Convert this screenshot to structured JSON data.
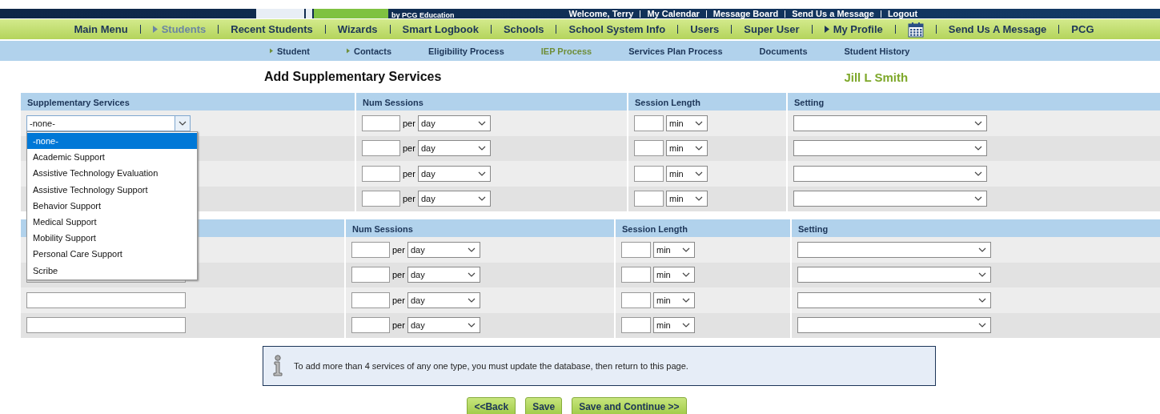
{
  "top_bar": {
    "brand": "by PCG Education",
    "links": [
      "Welcome, Terry",
      "My Calendar",
      "Message Board",
      "Send Us a Message",
      "Logout"
    ]
  },
  "main_nav": [
    {
      "kind": "link",
      "label": "Main Menu",
      "selected": false
    },
    {
      "kind": "arrow",
      "label": "Students",
      "selected": true
    },
    {
      "kind": "link",
      "label": "Recent Students",
      "selected": false
    },
    {
      "kind": "link",
      "label": "Wizards",
      "selected": false
    },
    {
      "kind": "link",
      "label": "Smart Logbook",
      "selected": false
    },
    {
      "kind": "link",
      "label": "Schools",
      "selected": false
    },
    {
      "kind": "link",
      "label": "School System Info",
      "selected": false
    },
    {
      "kind": "link",
      "label": "Users",
      "selected": false
    },
    {
      "kind": "link",
      "label": "Super User",
      "selected": false
    },
    {
      "kind": "arrow",
      "label": "My Profile",
      "selected": false
    },
    {
      "kind": "calendar",
      "selected": false
    },
    {
      "kind": "link",
      "label": "Send Us A Message",
      "selected": false
    },
    {
      "kind": "link",
      "label": "PCG",
      "selected": false
    }
  ],
  "sub_nav": [
    {
      "kind": "arrow",
      "label": "Student",
      "selected": false
    },
    {
      "kind": "arrow",
      "label": "Contacts",
      "selected": false
    },
    {
      "kind": "link",
      "label": "Eligibility Process",
      "selected": false
    },
    {
      "kind": "link",
      "label": "IEP Process",
      "selected": true
    },
    {
      "kind": "link",
      "label": "Services Plan Process",
      "selected": false
    },
    {
      "kind": "link",
      "label": "Documents",
      "selected": false
    },
    {
      "kind": "link",
      "label": "Student History",
      "selected": false
    }
  ],
  "page_title": "Add Supplementary Services",
  "student_name": "Jill L Smith",
  "tables": [
    {
      "service_header": "Supplementary Services",
      "columns": [
        "Num Sessions",
        "Session Length",
        "Setting"
      ],
      "rows": [
        {
          "kind": "select",
          "service": "-none-",
          "per": "per",
          "period": "day",
          "unit": "min"
        },
        {
          "kind": "covered",
          "per": "per",
          "period": "day",
          "unit": "min"
        },
        {
          "kind": "covered",
          "per": "per",
          "period": "day",
          "unit": "min"
        },
        {
          "kind": "covered",
          "per": "per",
          "period": "day",
          "unit": "min"
        }
      ]
    },
    {
      "columns": [
        "Num Sessions",
        "Session Length",
        "Setting"
      ],
      "rows": [
        {
          "kind": "covered",
          "per": "per",
          "period": "day",
          "unit": "min"
        },
        {
          "kind": "input",
          "per": "per",
          "period": "day",
          "unit": "min"
        },
        {
          "kind": "input",
          "per": "per",
          "period": "day",
          "unit": "min"
        },
        {
          "kind": "input",
          "per": "per",
          "period": "day",
          "unit": "min"
        }
      ]
    }
  ],
  "dropdown": {
    "options": [
      {
        "label": "-none-",
        "selected": true
      },
      {
        "label": "Academic Support",
        "selected": false
      },
      {
        "label": "Assistive Technology Evaluation",
        "selected": false
      },
      {
        "label": "Assistive Technology Support",
        "selected": false
      },
      {
        "label": "Behavior Support",
        "selected": false
      },
      {
        "label": "Medical Support",
        "selected": false
      },
      {
        "label": "Mobility Support",
        "selected": false
      },
      {
        "label": "Personal Care Support",
        "selected": false
      },
      {
        "label": "Scribe",
        "selected": false
      }
    ]
  },
  "info": "To add more than 4 services of any one type, you must update the database, then return to this page.",
  "buttons": [
    "<<Back",
    "Save",
    "Save and Continue >>"
  ]
}
